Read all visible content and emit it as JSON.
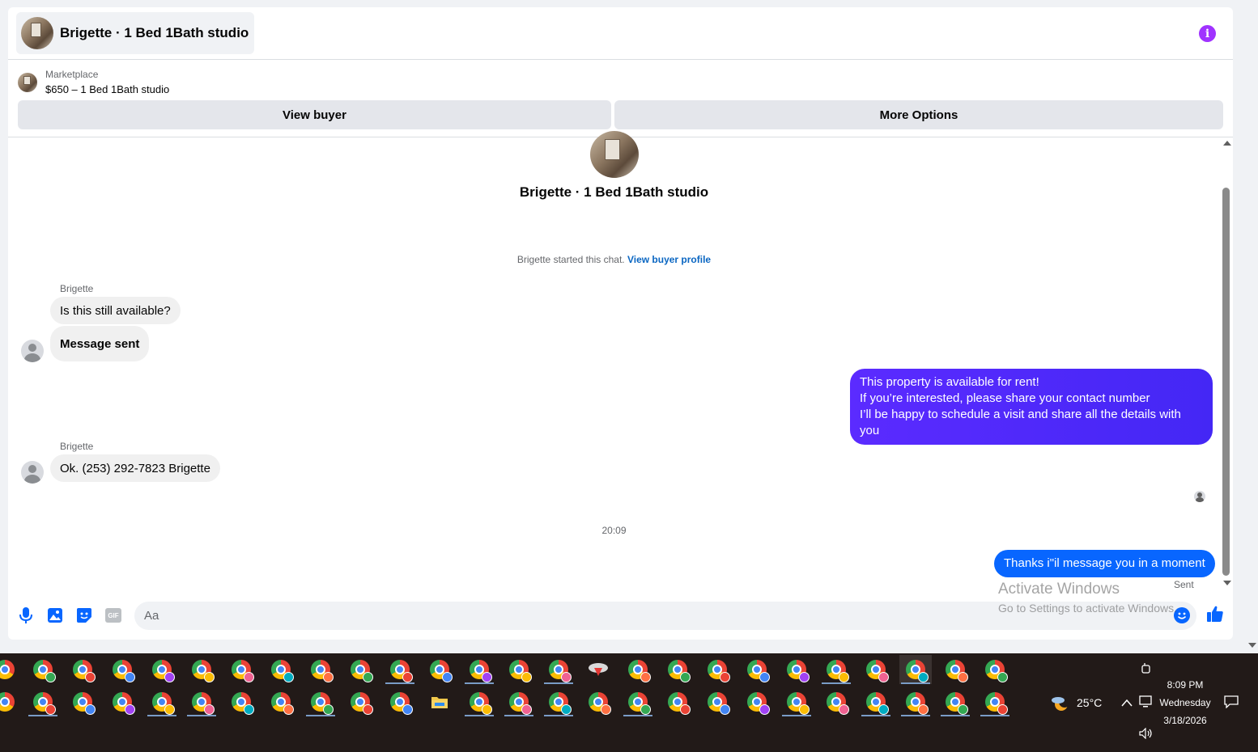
{
  "header": {
    "title": "Brigette · 1 Bed 1Bath studio"
  },
  "listing": {
    "label": "Marketplace",
    "price_title": "$650 – 1 Bed 1Bath studio"
  },
  "actions": {
    "view_buyer": "View buyer",
    "more_options": "More Options"
  },
  "thread": {
    "profile_name": "Brigette · 1 Bed 1Bath studio",
    "started_text": "Brigette started this chat.",
    "started_link": "View buyer profile",
    "messages": [
      {
        "sender": "Brigette",
        "text": "Is this still available?"
      },
      {
        "text": "Message sent"
      },
      {
        "text_lines": [
          "This property is available for rent!",
          "If you’re interested, please share your contact number",
          "I’ll be happy to schedule a visit and share all the details with you"
        ]
      },
      {
        "sender": "Brigette",
        "text": "Ok. (253) 292-7823 Brigette"
      },
      {
        "text": "Thanks i\"il message you in a moment"
      }
    ],
    "timestamp": "20:09",
    "sent_status": "Sent"
  },
  "composer": {
    "placeholder": "Aa",
    "gif_label": "GIF"
  },
  "watermark": {
    "line1": "Activate Windows",
    "line2": "Go to Settings to activate Windows."
  },
  "taskbar": {
    "temperature": "25°C",
    "time": "8:09 PM",
    "day": "Wednesday",
    "date": "3/18/2026"
  },
  "colors": {
    "accent_purple": "#a033ff",
    "bubble_gradient_start": "#5b2bff",
    "bubble_blue": "#0866ff",
    "link_blue": "#0a66c2"
  }
}
